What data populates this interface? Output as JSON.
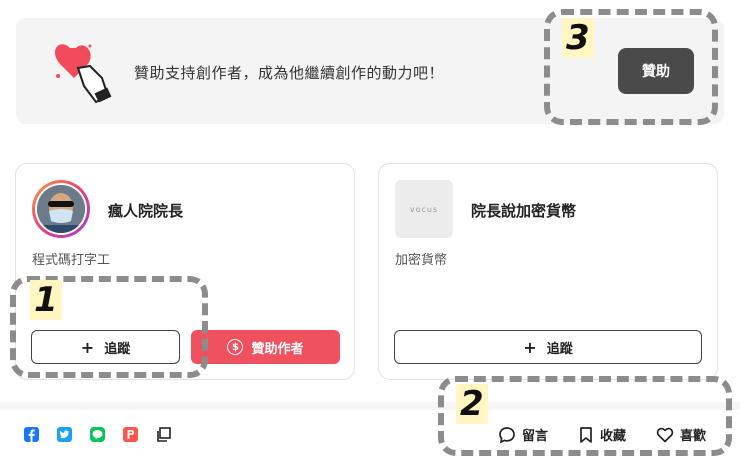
{
  "banner": {
    "text": "贊助支持創作者，成為他繼續創作的動力吧！",
    "button_label": "贊助"
  },
  "cards": [
    {
      "name": "瘋人院院長",
      "description": "程式碼打字工",
      "follow_label": "追蹤",
      "sponsor_label": "贊助作者"
    },
    {
      "name": "院長說加密貨幣",
      "description": "加密貨幣",
      "follow_label": "追蹤",
      "logo_text": "vocus"
    }
  ],
  "footer": {
    "share_icons": [
      "facebook-icon",
      "twitter-icon",
      "line-icon",
      "plurk-icon",
      "copy-link-icon"
    ],
    "actions": {
      "comment_label": "留言",
      "bookmark_label": "收藏",
      "like_label": "喜歡"
    }
  },
  "annotations": {
    "one": "1",
    "two": "2",
    "three": "3"
  },
  "colors": {
    "sponsor_red": "#f0515e",
    "banner_button": "#4a4a4a",
    "facebook": "#1877f2",
    "twitter": "#1da1f2",
    "line": "#06c755",
    "plurk": "#ff574d"
  }
}
